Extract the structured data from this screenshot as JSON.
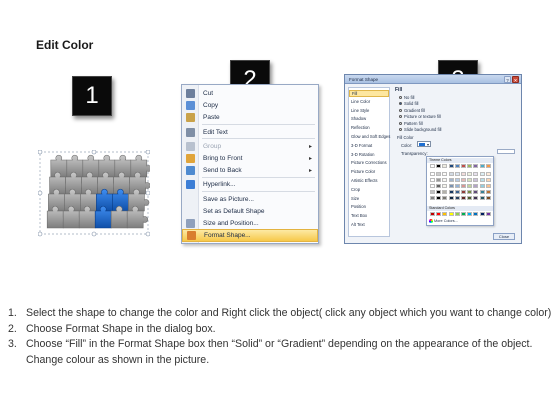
{
  "title": "Edit Color",
  "step_numbers": [
    "1",
    "2",
    "3"
  ],
  "context_menu": {
    "items": [
      {
        "label": "Cut",
        "icon": "scissors-icon",
        "disabled": false,
        "submenu": false
      },
      {
        "label": "Copy",
        "icon": "copy-icon",
        "disabled": false,
        "submenu": false
      },
      {
        "label": "Paste",
        "icon": "paste-icon",
        "disabled": false,
        "submenu": false
      },
      {
        "label": "Edit Text",
        "icon": "edit-text-icon",
        "disabled": false,
        "submenu": false
      },
      {
        "label": "Group",
        "icon": "group-icon",
        "disabled": true,
        "submenu": true
      },
      {
        "label": "Bring to Front",
        "icon": "bring-front-icon",
        "disabled": false,
        "submenu": true
      },
      {
        "label": "Send to Back",
        "icon": "send-back-icon",
        "disabled": false,
        "submenu": true
      },
      {
        "label": "Hyperlink...",
        "icon": "hyperlink-icon",
        "disabled": false,
        "submenu": false
      },
      {
        "label": "Save as Picture...",
        "icon": "",
        "disabled": false,
        "submenu": false
      },
      {
        "label": "Set as Default Shape",
        "icon": "",
        "disabled": false,
        "submenu": false
      },
      {
        "label": "Size and Position...",
        "icon": "size-position-icon",
        "disabled": false,
        "submenu": false
      },
      {
        "label": "Format Shape...",
        "icon": "format-shape-icon",
        "disabled": false,
        "submenu": false,
        "highlighted": true
      }
    ]
  },
  "dialog": {
    "title": "Format Shape",
    "sidebar": [
      "Fill",
      "Line Color",
      "Line Style",
      "Shadow",
      "Reflection",
      "Glow and Soft Edges",
      "3-D Format",
      "3-D Rotation",
      "Picture Corrections",
      "Picture Color",
      "Artistic Effects",
      "Crop",
      "Size",
      "Position",
      "Text Box",
      "Alt Text"
    ],
    "selected_section": "Fill",
    "fill_heading": "Fill",
    "fill_options": [
      "No fill",
      "Solid fill",
      "Gradient fill",
      "Picture or texture fill",
      "Pattern fill",
      "Slide background fill"
    ],
    "selected_fill": "Solid fill",
    "fill_color_heading": "Fill Color",
    "color_label": "Color:",
    "transparency_label": "Transparency:",
    "theme_colors_label": "Theme Colors",
    "standard_colors_label": "Standard Colors",
    "more_colors_label": "More Colors...",
    "close_label": "Close"
  },
  "palette": {
    "theme_columns": [
      "#ffffff",
      "#000000",
      "#eeece1",
      "#1f497d",
      "#4f81bd",
      "#c0504d",
      "#9bbb59",
      "#8064a2",
      "#4bacc6",
      "#f79646"
    ],
    "standard": [
      "#c00000",
      "#ff0000",
      "#ffc000",
      "#ffff00",
      "#92d050",
      "#00b050",
      "#00b0f0",
      "#0070c0",
      "#002060",
      "#7030a0"
    ]
  },
  "colors": {
    "puzzle_gray": "#9a9a9a",
    "puzzle_blue": "#1f6fd1",
    "menu_highlight": "#f7c84a"
  },
  "instructions": [
    {
      "n": "1.",
      "text": "Select the shape to change the color and Right click the object( click any object which you want to change color)"
    },
    {
      "n": "2.",
      "text": "Choose Format Shape in the dialog box."
    },
    {
      "n": "3.",
      "text": "Choose “Fill” in the Format Shape box then “Solid” or “Gradient” depending on the appearance of the object. Change colour as shown in the picture."
    }
  ]
}
